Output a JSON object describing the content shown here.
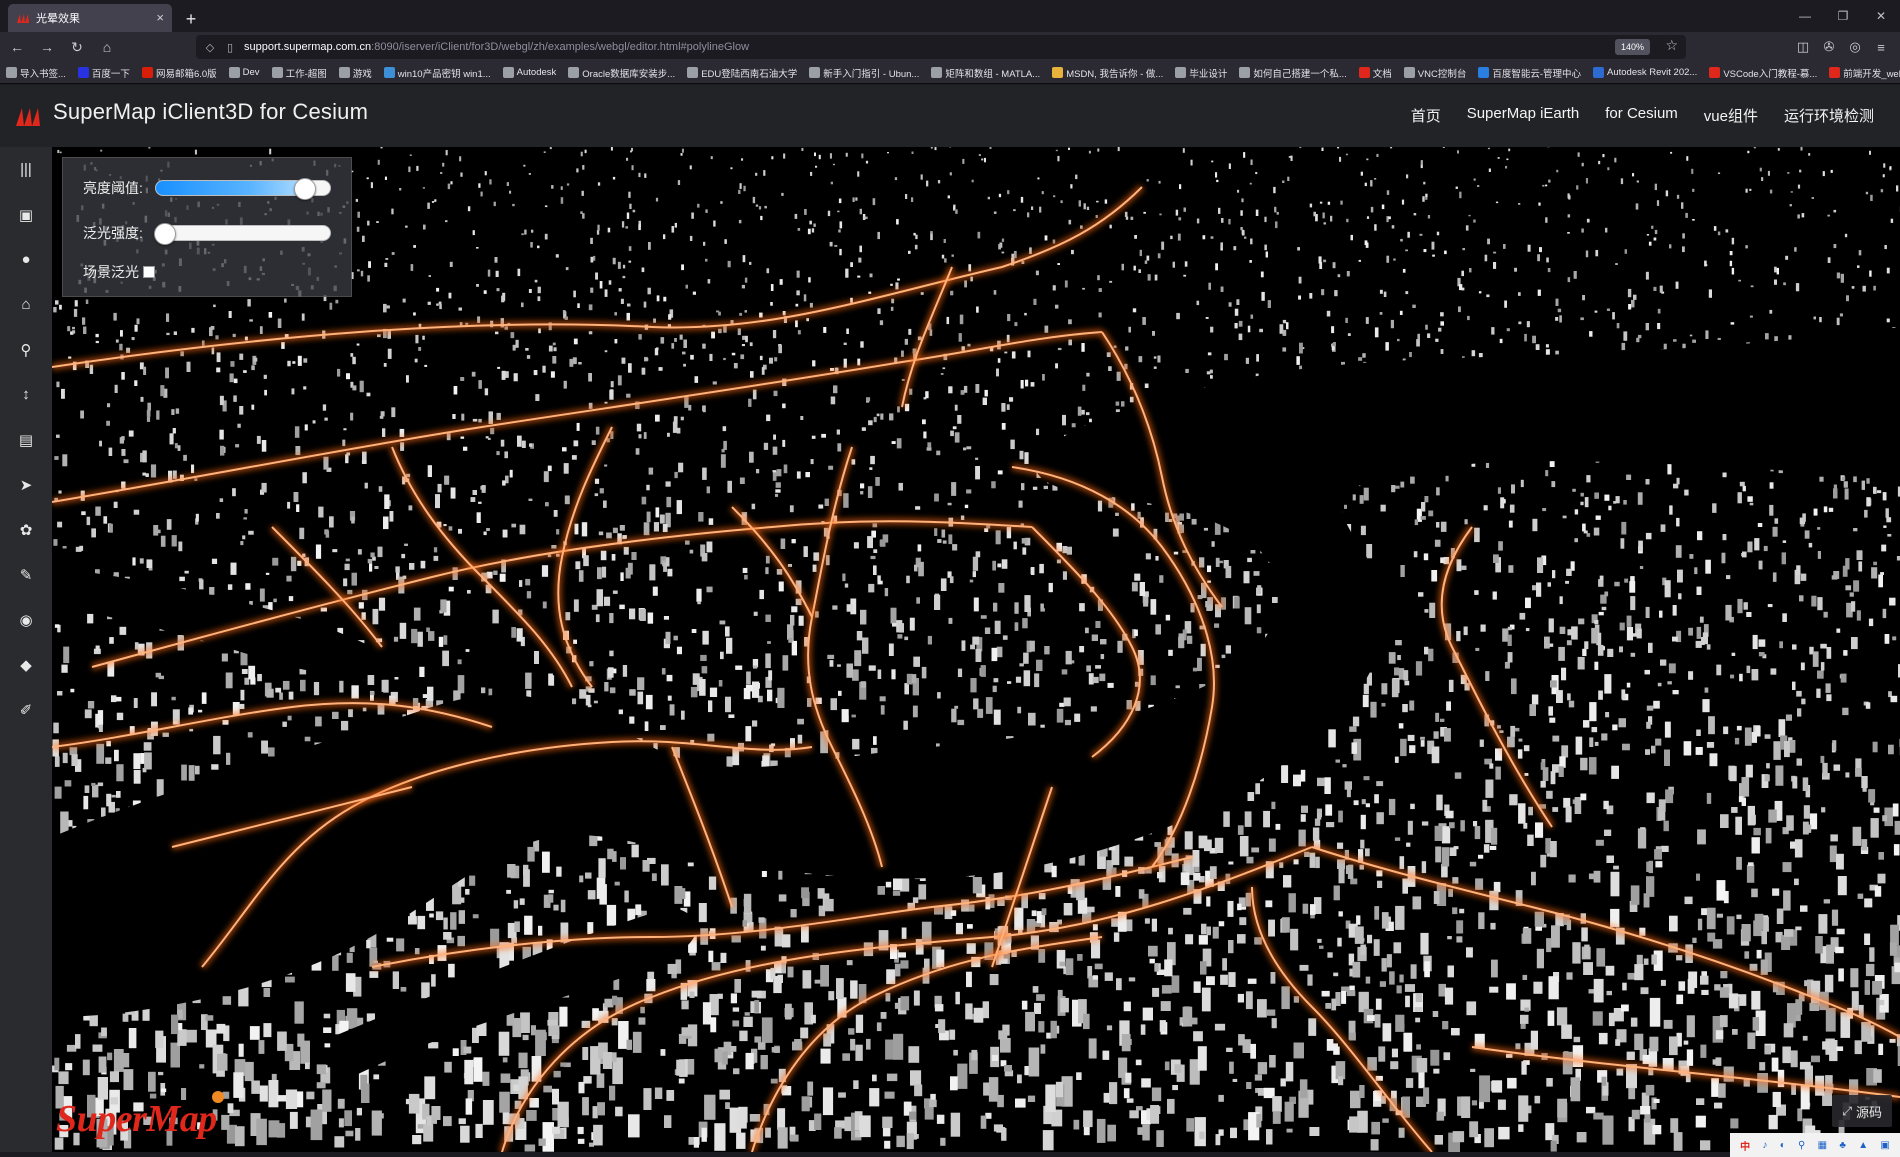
{
  "browser": {
    "tab_title": "光晕效果",
    "tab_close": "×",
    "new_tab": "+",
    "window_controls": {
      "minimize": "—",
      "restore": "❐",
      "close": "✕"
    },
    "url_domain": "support.supermap.com.cn",
    "url_path": ":8090/iserver/iClient/for3D/webgl/zh/examples/webgl/editor.html#polylineGlow",
    "zoom": "140%",
    "bookmarks": [
      {
        "label": "导入书签...",
        "color": "#9aa0a6"
      },
      {
        "label": "百度一下",
        "color": "#2932e1"
      },
      {
        "label": "网易邮箱6.0版",
        "color": "#d81e06"
      },
      {
        "label": "Dev",
        "color": "#9aa0a6"
      },
      {
        "label": "工作-超图",
        "color": "#9aa0a6"
      },
      {
        "label": "游戏",
        "color": "#9aa0a6"
      },
      {
        "label": "win10产品密钥 win1...",
        "color": "#3d8fd6"
      },
      {
        "label": "Autodesk",
        "color": "#9aa0a6"
      },
      {
        "label": "Oracle数据库安装步...",
        "color": "#9aa0a6"
      },
      {
        "label": "EDU登陆西南石油大学",
        "color": "#9aa0a6"
      },
      {
        "label": "新手入门指引 - Ubun...",
        "color": "#9aa0a6"
      },
      {
        "label": "矩阵和数组 - MATLA...",
        "color": "#9aa0a6"
      },
      {
        "label": "MSDN, 我告诉你 - 做...",
        "color": "#e8b33a"
      },
      {
        "label": "毕业设计",
        "color": "#9aa0a6"
      },
      {
        "label": "如何自己搭建一个私...",
        "color": "#9aa0a6"
      },
      {
        "label": "文档",
        "color": "#e0271c"
      },
      {
        "label": "VNC控制台",
        "color": "#9aa0a6"
      },
      {
        "label": "百度智能云-管理中心",
        "color": "#2a7de1"
      },
      {
        "label": "Autodesk Revit 202...",
        "color": "#2d6bd0"
      },
      {
        "label": "VSCode入门教程-慕...",
        "color": "#e0271c"
      },
      {
        "label": "前端开发_web前端开...",
        "color": "#e0271c"
      }
    ]
  },
  "header": {
    "title": "SuperMap iClient3D for Cesium",
    "nav": [
      "首页",
      "SuperMap iEarth",
      "for Cesium",
      "vue组件",
      "运行环境检测"
    ]
  },
  "sidebar": {
    "items": [
      {
        "icon": "menu-icon",
        "glyph": "|||"
      },
      {
        "icon": "layers-icon",
        "glyph": "▣"
      },
      {
        "icon": "globe-icon",
        "glyph": "●"
      },
      {
        "icon": "building-icon",
        "glyph": "⌂"
      },
      {
        "icon": "search-icon",
        "glyph": "⚲"
      },
      {
        "icon": "measure-icon",
        "glyph": "↕"
      },
      {
        "icon": "map-icon",
        "glyph": "▤"
      },
      {
        "icon": "plane-icon",
        "glyph": "➤"
      },
      {
        "icon": "effects-icon",
        "glyph": "✿"
      },
      {
        "icon": "edit-icon",
        "glyph": "✎"
      },
      {
        "icon": "eye-icon",
        "glyph": "◉"
      },
      {
        "icon": "cube-icon",
        "glyph": "◆"
      },
      {
        "icon": "pencil-icon",
        "glyph": "✐"
      }
    ]
  },
  "panel": {
    "brightness_label": "亮度阈值:",
    "brightness_value": 0.9,
    "bloom_label": "泛光强度:",
    "bloom_value": 0.0,
    "scene_bloom_label": "场景泛光",
    "scene_bloom_checked": false
  },
  "map": {
    "brand": "SuperMap",
    "source_button": "源码",
    "glow_color": "#ff6a1a",
    "building_color": "#d9d9d9"
  },
  "tray": [
    "中",
    "♪",
    "◐",
    "⚲",
    "▦",
    "♣",
    "▲",
    "▣"
  ]
}
